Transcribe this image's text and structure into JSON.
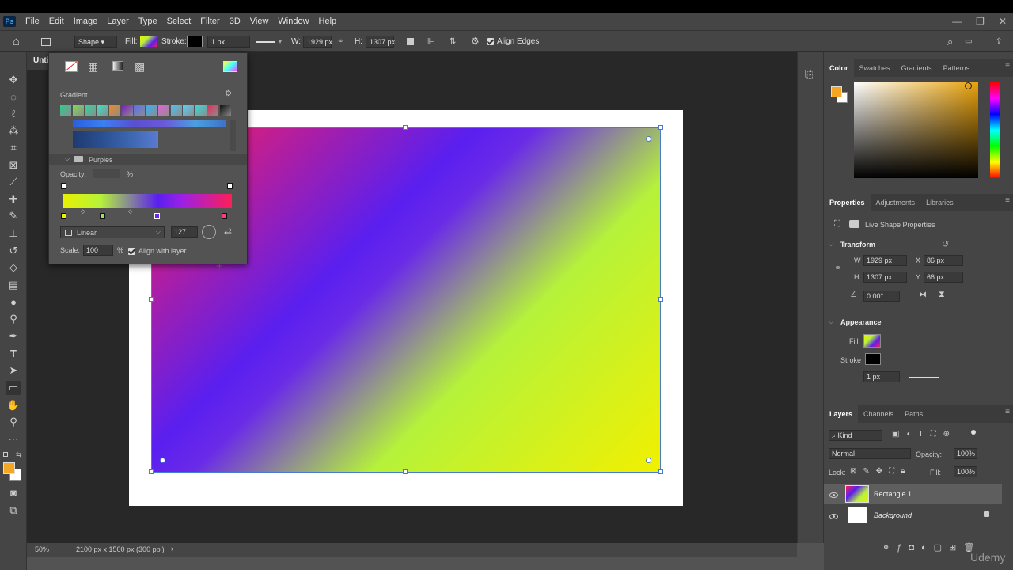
{
  "app": {
    "logo": "Ps"
  },
  "menu": [
    "File",
    "Edit",
    "Image",
    "Layer",
    "Type",
    "Select",
    "Filter",
    "3D",
    "View",
    "Window",
    "Help"
  ],
  "options": {
    "mode": "Shape",
    "fill_label": "Fill:",
    "stroke_label": "Stroke:",
    "stroke_width": "1 px",
    "w_label": "W:",
    "w_value": "1929 px",
    "h_label": "H:",
    "h_value": "1307 px",
    "align_edges": "Align Edges"
  },
  "doc_tab": "Unti",
  "status": {
    "zoom": "50%",
    "info": "2100 px x 1500 px (300 ppi)"
  },
  "gradient_popup": {
    "section_label": "Gradient",
    "folder_label": "Purples",
    "opacity_label": "Opacity:",
    "opacity_unit": "%",
    "type": "Linear",
    "angle": "127",
    "scale_label": "Scale:",
    "scale_value": "100",
    "scale_unit": "%",
    "align_with_layer": "Align with layer",
    "preset_colors": [
      "#2ecc8f",
      "#7ed957",
      "#2ed8a0",
      "#3de0c0",
      "#f08a24",
      "#7a1fbe",
      "#5a6ff0",
      "#3ab0f0",
      "#e066d8",
      "#50c0f0",
      "#58d0f8",
      "#3ad8d8",
      "#e0305a",
      "#101010"
    ]
  },
  "color_panel": {
    "tabs": [
      "Color",
      "Swatches",
      "Gradients",
      "Patterns"
    ],
    "fg": "#f5a623"
  },
  "properties_panel": {
    "tabs": [
      "Properties",
      "Adjustments",
      "Libraries"
    ],
    "subtitle": "Live Shape Properties",
    "transform_label": "Transform",
    "w_label": "W",
    "w_value": "1929 px",
    "x_label": "X",
    "x_value": "86 px",
    "h_label": "H",
    "h_value": "1307 px",
    "y_label": "Y",
    "y_value": "66 px",
    "angle_value": "0.00°",
    "appearance_label": "Appearance",
    "fill_label": "Fill",
    "stroke_label": "Stroke",
    "stroke_width": "1 px"
  },
  "layers_panel": {
    "tabs": [
      "Layers",
      "Channels",
      "Paths"
    ],
    "kind": "Kind",
    "blend": "Normal",
    "opacity_label": "Opacity:",
    "opacity_value": "100%",
    "lock_label": "Lock:",
    "fill_label": "Fill:",
    "fill_value": "100%",
    "layers": [
      {
        "name": "Rectangle 1"
      },
      {
        "name": "Background"
      }
    ]
  },
  "watermark": "Udemy"
}
